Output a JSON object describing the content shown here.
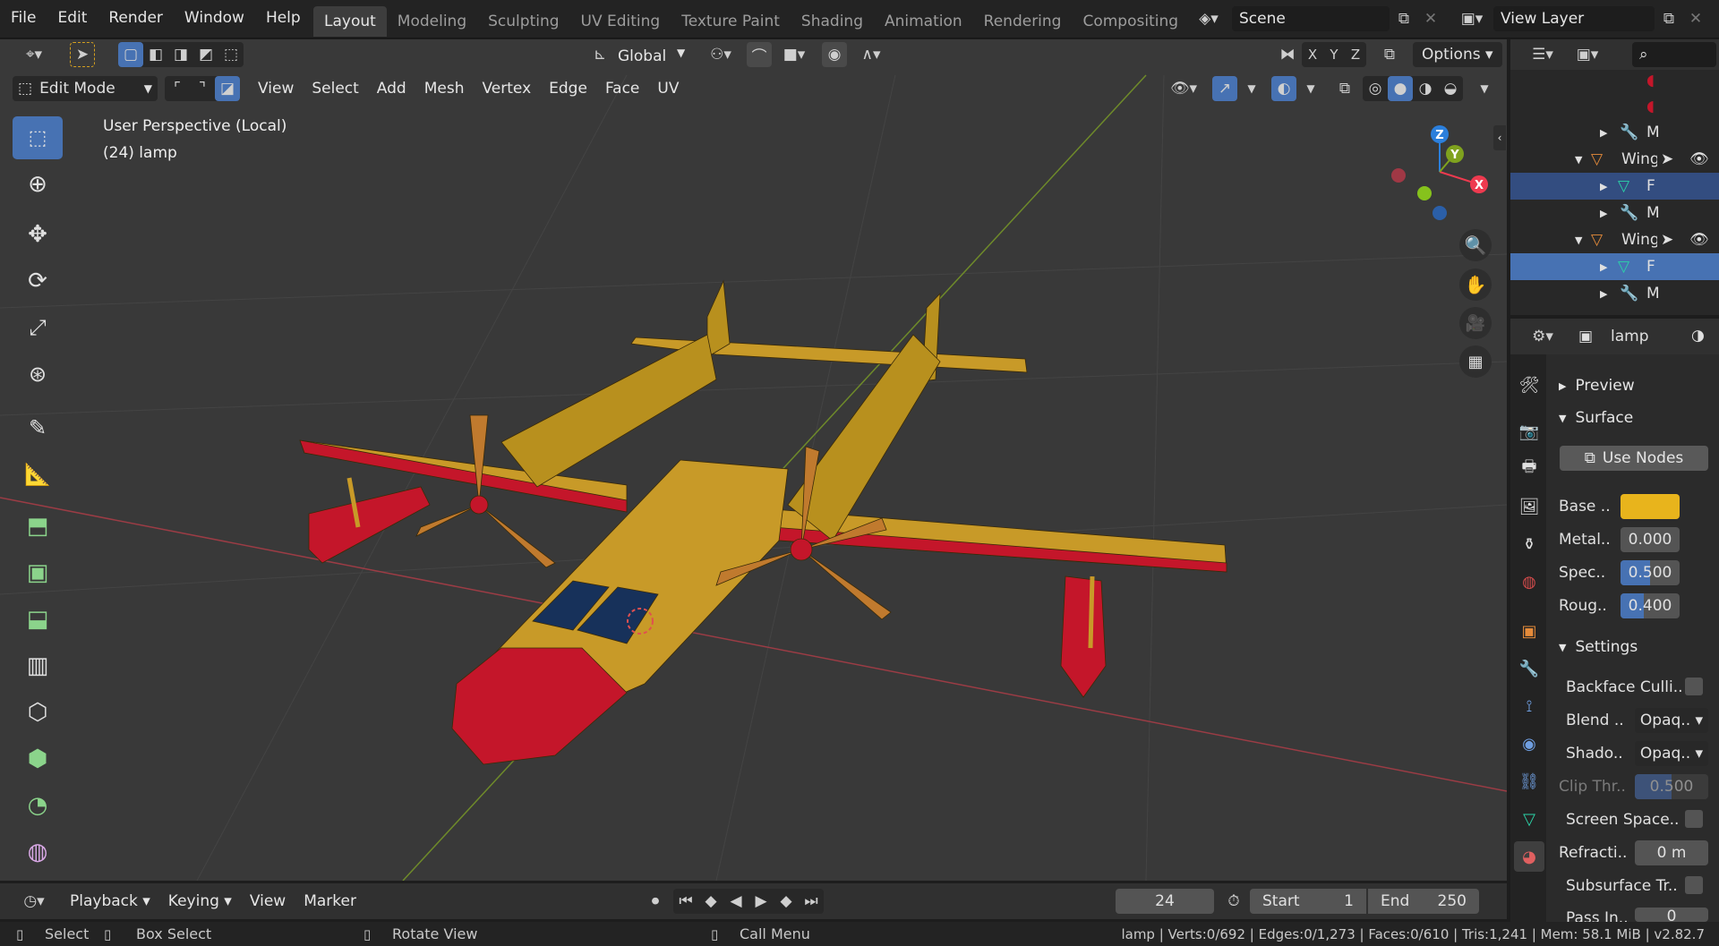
{
  "topbar": {
    "menus": [
      "File",
      "Edit",
      "Render",
      "Window",
      "Help"
    ],
    "workspaces": [
      "Layout",
      "Modeling",
      "Sculpting",
      "UV Editing",
      "Texture Paint",
      "Shading",
      "Animation",
      "Rendering",
      "Compositing"
    ],
    "active_workspace": "Layout",
    "scene": "Scene",
    "view_layer": "View Layer"
  },
  "viewport_header": {
    "orientation": "Global",
    "axes": [
      "X",
      "Y",
      "Z"
    ],
    "options": "Options",
    "mode": "Edit Mode",
    "menus": [
      "View",
      "Select",
      "Add",
      "Mesh",
      "Vertex",
      "Edge",
      "Face",
      "UV"
    ]
  },
  "viewport": {
    "overlay_line1": "User Perspective (Local)",
    "overlay_line2": "(24) lamp",
    "gizmo": {
      "z": "Z",
      "y": "Y",
      "x": "X"
    }
  },
  "outliner": {
    "rows": [
      {
        "label": "",
        "type": "material"
      },
      {
        "label": "",
        "type": "material"
      },
      {
        "label": "M",
        "type": "modifier"
      },
      {
        "label": "Wing",
        "type": "object"
      },
      {
        "label": "F",
        "type": "mesh"
      },
      {
        "label": "M",
        "type": "modifier"
      },
      {
        "label": "Wing",
        "type": "object"
      },
      {
        "label": "F",
        "type": "mesh"
      },
      {
        "label": "M",
        "type": "modifier"
      }
    ]
  },
  "properties": {
    "material_name": "lamp",
    "panels": {
      "preview": "Preview",
      "surface": "Surface",
      "settings": "Settings"
    },
    "use_nodes": "Use Nodes",
    "base_color_label": "Base ..",
    "base_color": "#e8b41c",
    "metal_label": "Metal..",
    "metal_value": "0.000",
    "spec_label": "Spec..",
    "spec_value": "0.500",
    "spec_fill": 0.5,
    "rough_label": "Roug..",
    "rough_value": "0.400",
    "rough_fill": 0.4,
    "backface_label": "Backface Culli..",
    "blend_label": "Blend ..",
    "blend_value": "Opaq..",
    "shadow_label": "Shado..",
    "shadow_value": "Opaq..",
    "clip_label": "Clip Thr..",
    "clip_value": "0.500",
    "clip_fill": 0.5,
    "ssr_label": "Screen Space..",
    "refraction_label": "Refracti..",
    "refraction_value": "0 m",
    "subsurface_label": "Subsurface Tr..",
    "pass_label": "Pass In..",
    "pass_value": "0"
  },
  "timeline": {
    "menus": [
      "Playback",
      "Keying",
      "View",
      "Marker"
    ],
    "current_frame": "24",
    "start_label": "Start",
    "start_value": "1",
    "end_label": "End",
    "end_value": "250"
  },
  "statusbar": {
    "select": "Select",
    "box_select": "Box Select",
    "rotate_view": "Rotate View",
    "call_menu": "Call Menu",
    "stats": "lamp | Verts:0/692 | Edges:0/1,273 | Faces:0/610 | Tris:1,241 | Mem: 58.1 MiB | v2.82.7"
  },
  "colors": {
    "accent": "#4772b3",
    "fuselage": "#b8901e",
    "trim": "#c4162a",
    "x_axis": "#ee3a4f",
    "y_axis": "#7fa21e",
    "z_axis": "#2b7fdc"
  }
}
